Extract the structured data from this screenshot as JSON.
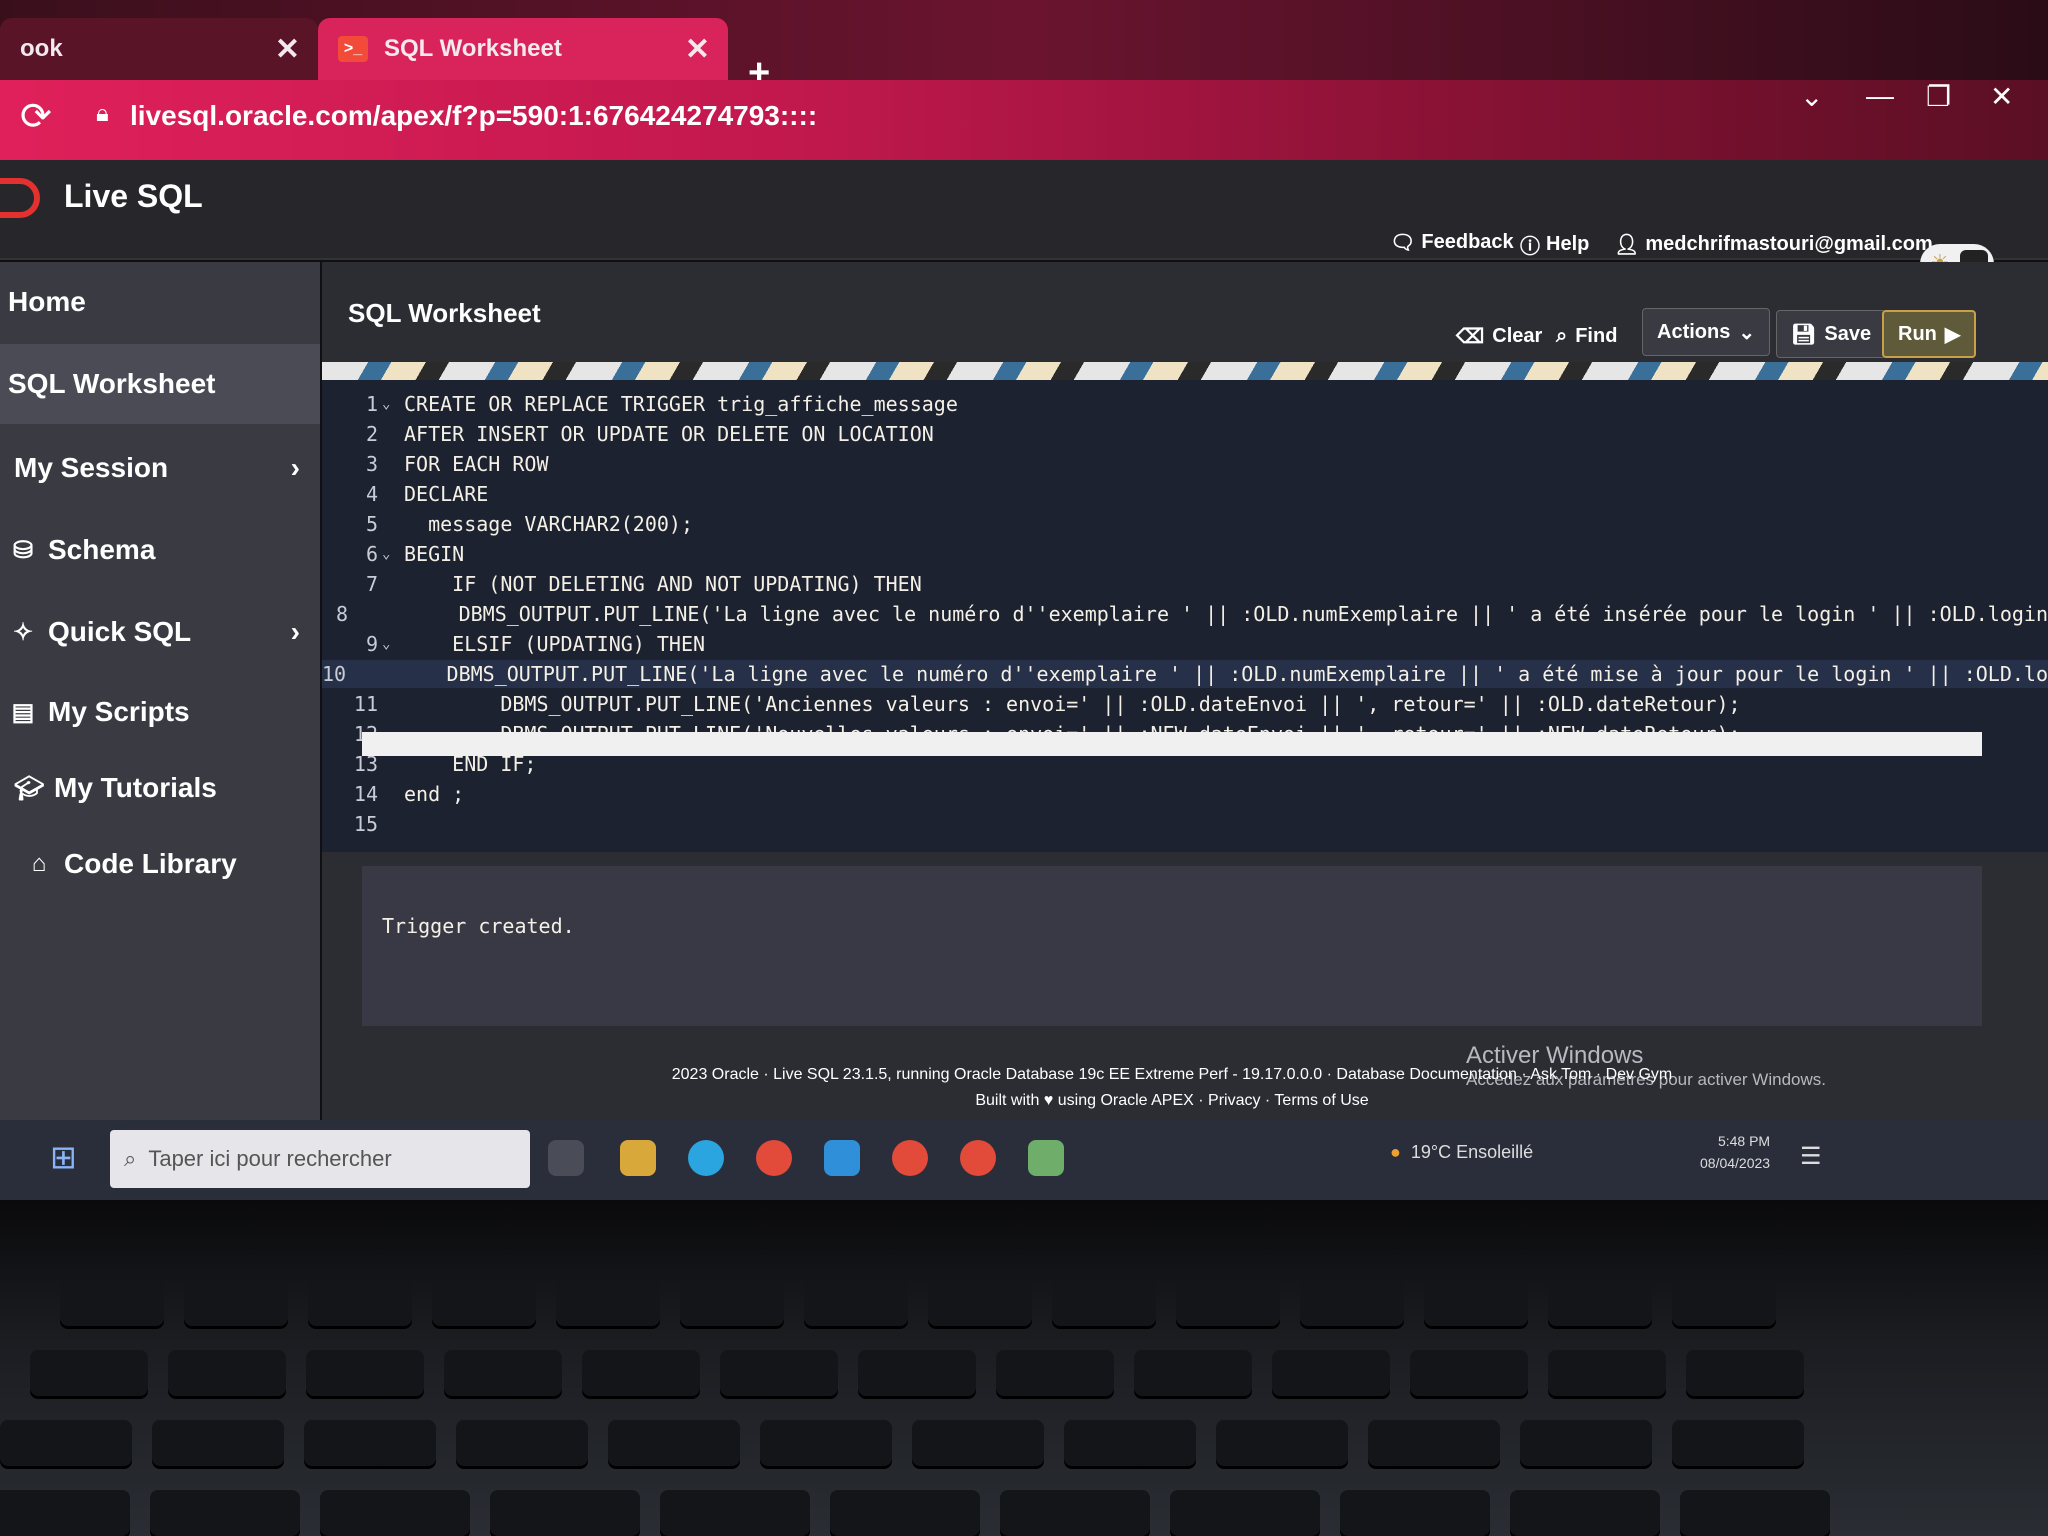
{
  "browser": {
    "tabs": [
      {
        "title": "ook",
        "active": false
      },
      {
        "title": "SQL Worksheet",
        "active": true
      }
    ],
    "close_glyph": "✕",
    "new_tab_glyph": "+",
    "url": "livesql.oracle.com/apex/f?p=590:1:676424274793::::",
    "reload_icon": "reload-icon",
    "window_controls": [
      "⌄",
      "—",
      "❐",
      "✕"
    ]
  },
  "app": {
    "title": "Live SQL",
    "header_links": {
      "feedback": "Feedback",
      "help": "Help",
      "user": "medchrifmastouri@gmail.com"
    }
  },
  "sidebar": {
    "items": [
      {
        "label": "Home",
        "icon": "",
        "has_submenu": false
      },
      {
        "label": "SQL Worksheet",
        "icon": "",
        "has_submenu": false,
        "active": true
      },
      {
        "label": "My Session",
        "icon": "",
        "has_submenu": true
      },
      {
        "label": "Schema",
        "icon": "database-icon",
        "has_submenu": false
      },
      {
        "label": "Quick SQL",
        "icon": "wand-icon",
        "has_submenu": true
      },
      {
        "label": "My Scripts",
        "icon": "document-icon",
        "has_submenu": false
      },
      {
        "label": "My Tutorials",
        "icon": "graduation-cap-icon",
        "has_submenu": false
      },
      {
        "label": "Code Library",
        "icon": "library-icon",
        "has_submenu": false
      }
    ]
  },
  "worksheet": {
    "title": "SQL Worksheet",
    "toolbar": {
      "clear": "Clear",
      "find": "Find",
      "actions": "Actions",
      "save": "Save",
      "run": "Run"
    },
    "code_lines": [
      {
        "n": "1",
        "fold": true,
        "text": "CREATE OR REPLACE TRIGGER trig_affiche_message"
      },
      {
        "n": "2",
        "fold": false,
        "text": "AFTER INSERT OR UPDATE OR DELETE ON LOCATION"
      },
      {
        "n": "3",
        "fold": false,
        "text": "FOR EACH ROW"
      },
      {
        "n": "4",
        "fold": false,
        "text": "DECLARE"
      },
      {
        "n": "5",
        "fold": false,
        "text": "  message VARCHAR2(200);"
      },
      {
        "n": "6",
        "fold": true,
        "text": "BEGIN"
      },
      {
        "n": "7",
        "fold": false,
        "text": "    IF (NOT DELETING AND NOT UPDATING) THEN"
      },
      {
        "n": "8",
        "fold": false,
        "text": "        DBMS_OUTPUT.PUT_LINE('La ligne avec le numéro d''exemplaire ' || :OLD.numExemplaire || ' a été insérée pour le login ' || :OLD.login"
      },
      {
        "n": "9",
        "fold": true,
        "text": "    ELSIF (UPDATING) THEN"
      },
      {
        "n": "10",
        "fold": false,
        "text": "        DBMS_OUTPUT.PUT_LINE('La ligne avec le numéro d''exemplaire ' || :OLD.numExemplaire || ' a été mise à jour pour le login ' || :OLD.lo",
        "active": true
      },
      {
        "n": "11",
        "fold": false,
        "text": "        DBMS_OUTPUT.PUT_LINE('Anciennes valeurs : envoi=' || :OLD.dateEnvoi || ', retour=' || :OLD.dateRetour);"
      },
      {
        "n": "12",
        "fold": false,
        "text": "        DBMS_OUTPUT.PUT_LINE('Nouvelles valeurs : envoi=' || :NEW.dateEnvoi || ', retour=' || :NEW.dateRetour);"
      },
      {
        "n": "13",
        "fold": false,
        "text": "    END IF;"
      },
      {
        "n": "14",
        "fold": false,
        "text": "end ;"
      },
      {
        "n": "15",
        "fold": false,
        "text": ""
      }
    ],
    "output": "Trigger created.",
    "footer_line1": "2023 Oracle · Live SQL 23.1.5, running Oracle Database 19c EE Extreme Perf - 19.17.0.0.0 · Database Documentation · Ask Tom · Dev Gym",
    "footer_line2": "Built with ♥ using Oracle APEX · Privacy · Terms of Use"
  },
  "watermark": {
    "line1": "Activer Windows",
    "line2": "Accédez aux paramètres pour activer Windows."
  },
  "taskbar": {
    "search_placeholder": "Taper ici pour rechercher",
    "weather": "19°C  Ensoleillé",
    "time": "5:48 PM",
    "date": "08/04/2023"
  },
  "colors": {
    "accent": "#d8245a",
    "run_border": "#c8a048"
  }
}
